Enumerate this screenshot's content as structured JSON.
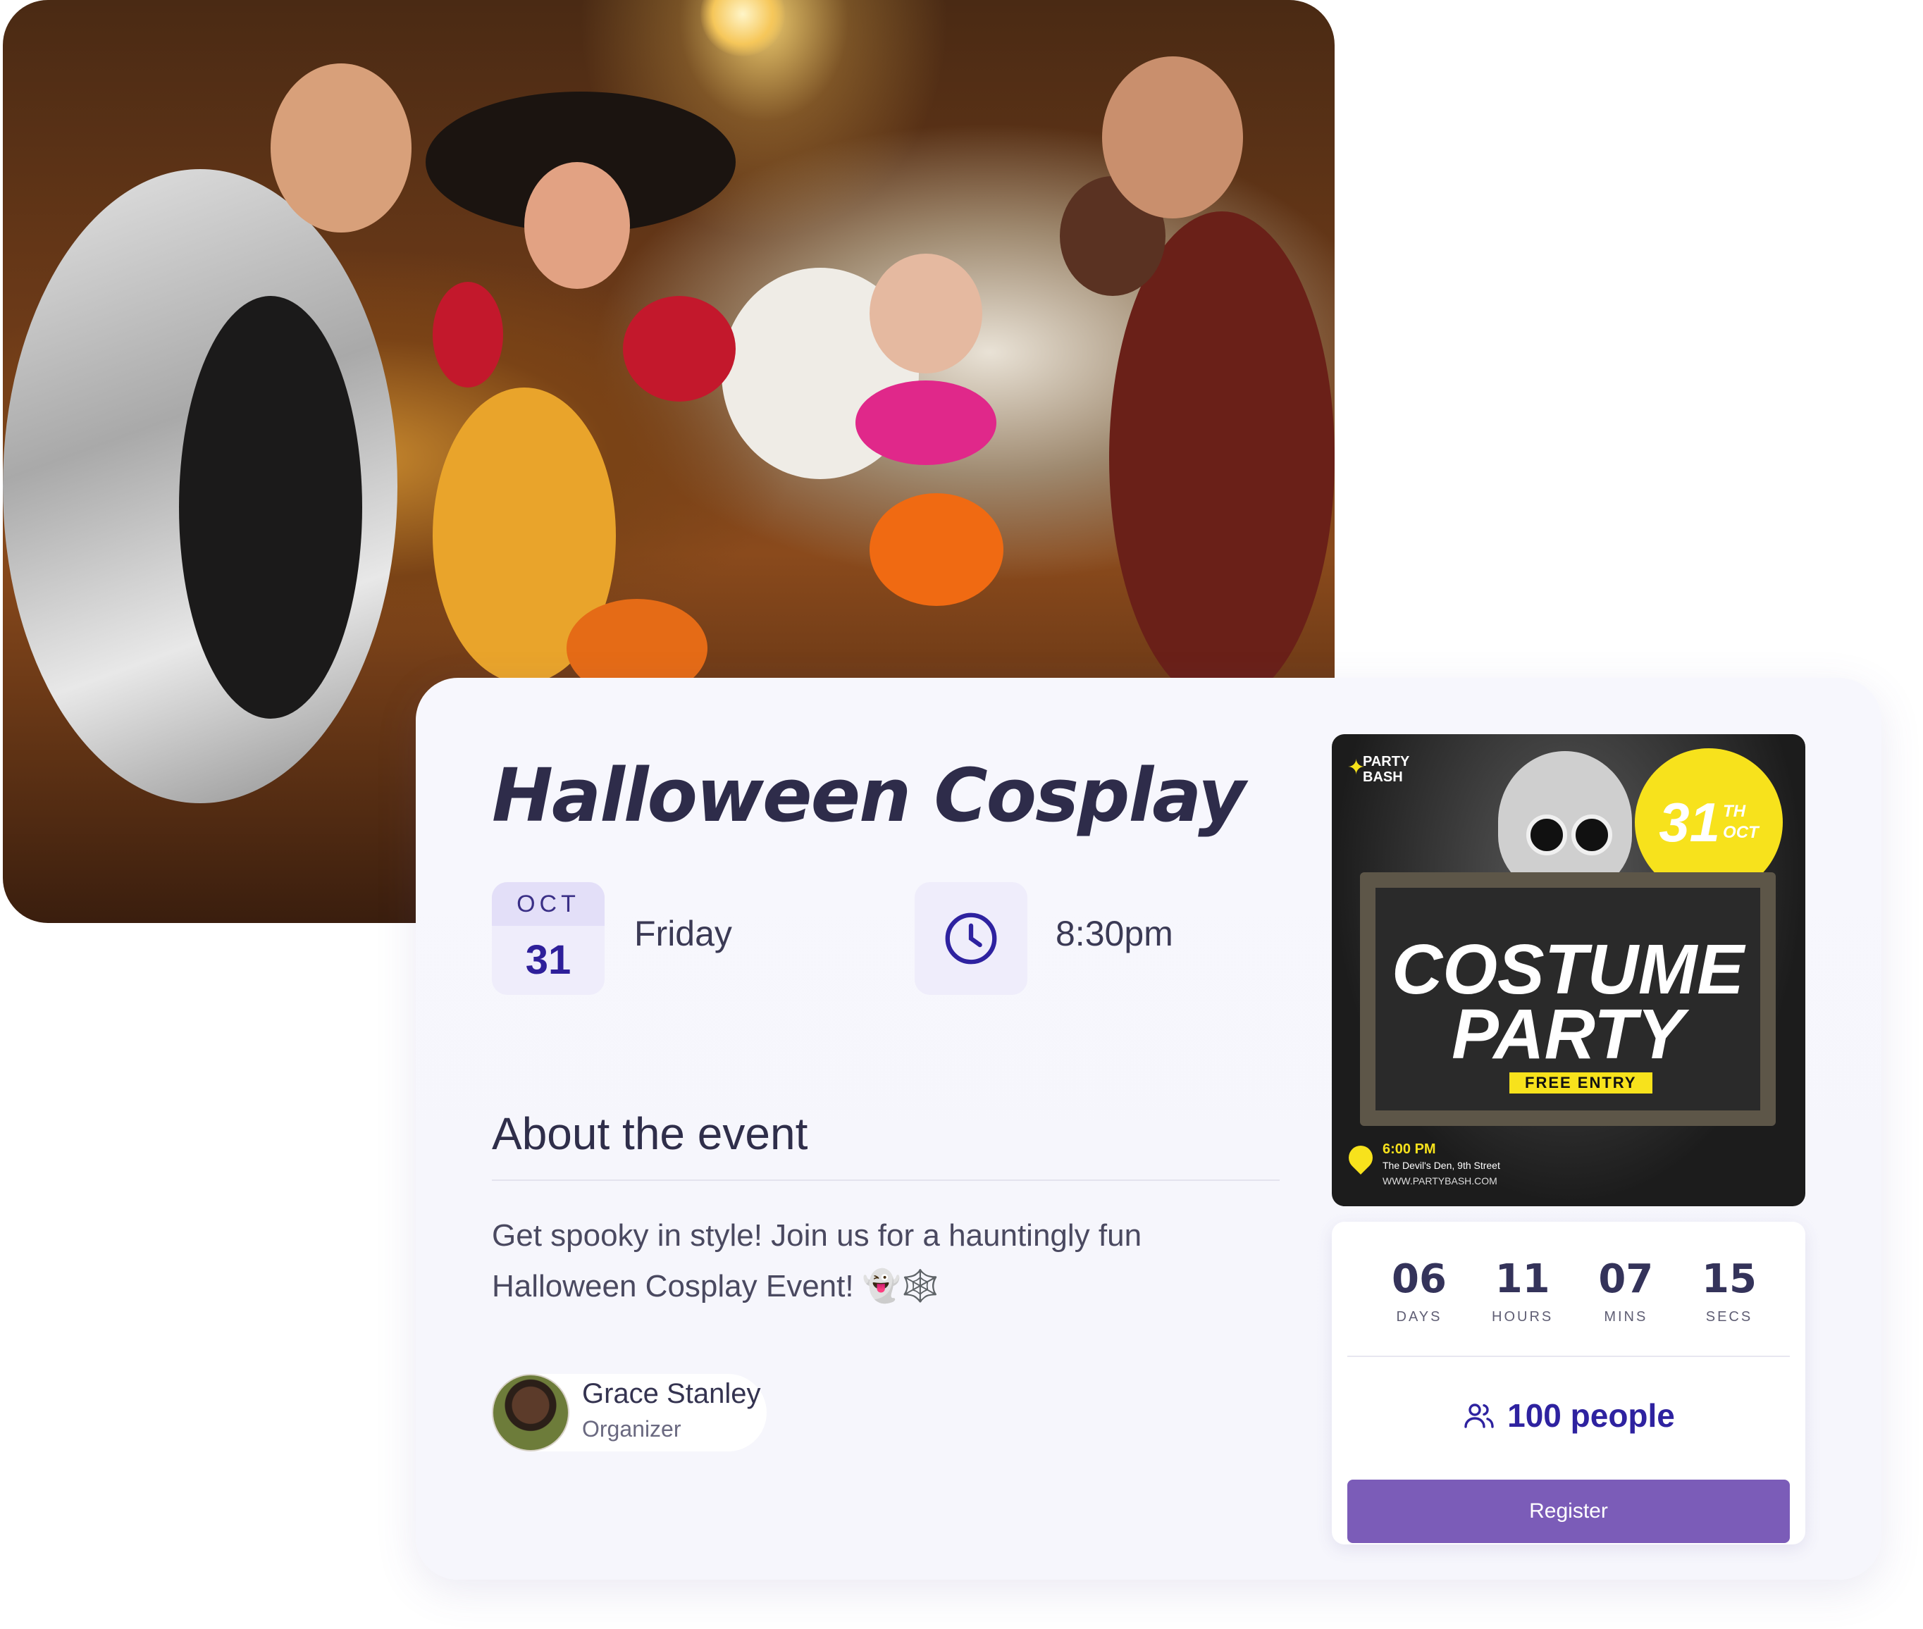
{
  "event": {
    "title": "Halloween Cosplay",
    "date": {
      "month": "OCT",
      "day": "31",
      "weekday": "Friday"
    },
    "time": "8:30pm",
    "about": {
      "heading": "About the event",
      "text": "Get spooky in style! Join us for a hauntingly fun Halloween Cosplay Event! 👻🕸️"
    },
    "organizer": {
      "name": "Grace Stanley",
      "role": "Organizer"
    }
  },
  "poster": {
    "brand_line1": "PARTY",
    "brand_line2": "BASH",
    "badge_day": "31",
    "badge_suffix": "TH",
    "badge_month": "OCT",
    "title_line1": "COSTUME",
    "title_line2": "PARTY",
    "banner": "FREE ENTRY",
    "time": "6:00 PM",
    "address": "The Devil's Den, 9th Street",
    "url": "WWW.PARTYBASH.COM"
  },
  "countdown": {
    "units": [
      {
        "value": "06",
        "label": "DAYS"
      },
      {
        "value": "11",
        "label": "HOURS"
      },
      {
        "value": "07",
        "label": "MINS"
      },
      {
        "value": "15",
        "label": "SECS"
      }
    ],
    "attendees": "100 people",
    "register_label": "Register"
  },
  "colors": {
    "accent": "#2e22a0",
    "button": "#7b5cb8",
    "tile_bg": "#efedfb",
    "poster_yellow": "#f7e21c"
  },
  "icons": {
    "time": "clock-icon",
    "attendees": "people-icon",
    "poster_location": "location-pin-icon"
  }
}
